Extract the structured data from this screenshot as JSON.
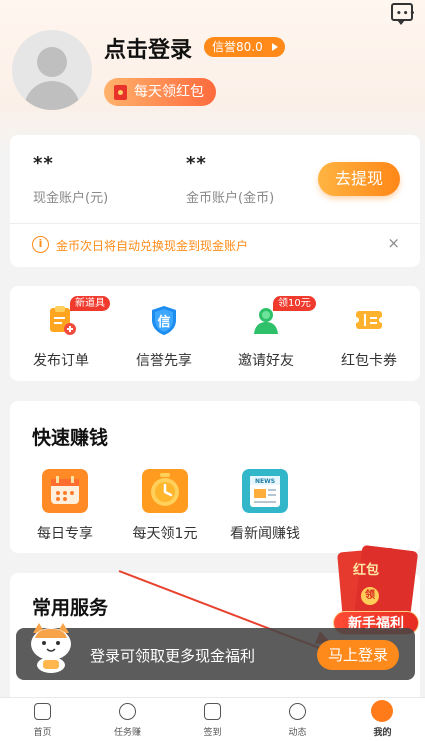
{
  "profile": {
    "login_title": "点击登录",
    "credit_badge": "信誉80.0",
    "daily_red_packet": "每天领红包"
  },
  "account": {
    "cash_amount": "**",
    "cash_label": "现金账户(元)",
    "coin_amount": "**",
    "coin_label": "金币账户(金币)",
    "withdraw_button": "去提现",
    "notice_icon": "i",
    "notice": "金币次日将自动兑换现金到现金账户",
    "close_icon": "×"
  },
  "tools": {
    "items": [
      {
        "label": "发布订单",
        "tag": "新道具",
        "icon": "order-icon"
      },
      {
        "label": "信誉先享",
        "tag": "",
        "icon": "credit-shield-icon"
      },
      {
        "label": "邀请好友",
        "tag": "领10元",
        "icon": "invite-friend-icon"
      },
      {
        "label": "红包卡券",
        "tag": "",
        "icon": "coupon-icon"
      }
    ]
  },
  "quick_earn": {
    "title": "快速赚钱",
    "items": [
      {
        "label": "每日专享",
        "icon": "calendar-icon"
      },
      {
        "label": "每天领1元",
        "icon": "clock-coin-icon"
      },
      {
        "label": "看新闻赚钱",
        "icon": "news-icon"
      }
    ]
  },
  "services": {
    "title": "常用服务"
  },
  "redpacket_popup": {
    "title": "红包",
    "coin": "领",
    "ribbon": "新手福利"
  },
  "login_toast": {
    "text": "登录可领取更多现金福利",
    "button": "马上登录"
  },
  "tabbar": {
    "items": [
      {
        "label": "首页"
      },
      {
        "label": "任务赚"
      },
      {
        "label": "签到"
      },
      {
        "label": "动态"
      },
      {
        "label": "我的"
      }
    ]
  },
  "colors": {
    "accent": "#ff8a1a",
    "red": "#e73a2f",
    "background": "#f3f3f3"
  }
}
